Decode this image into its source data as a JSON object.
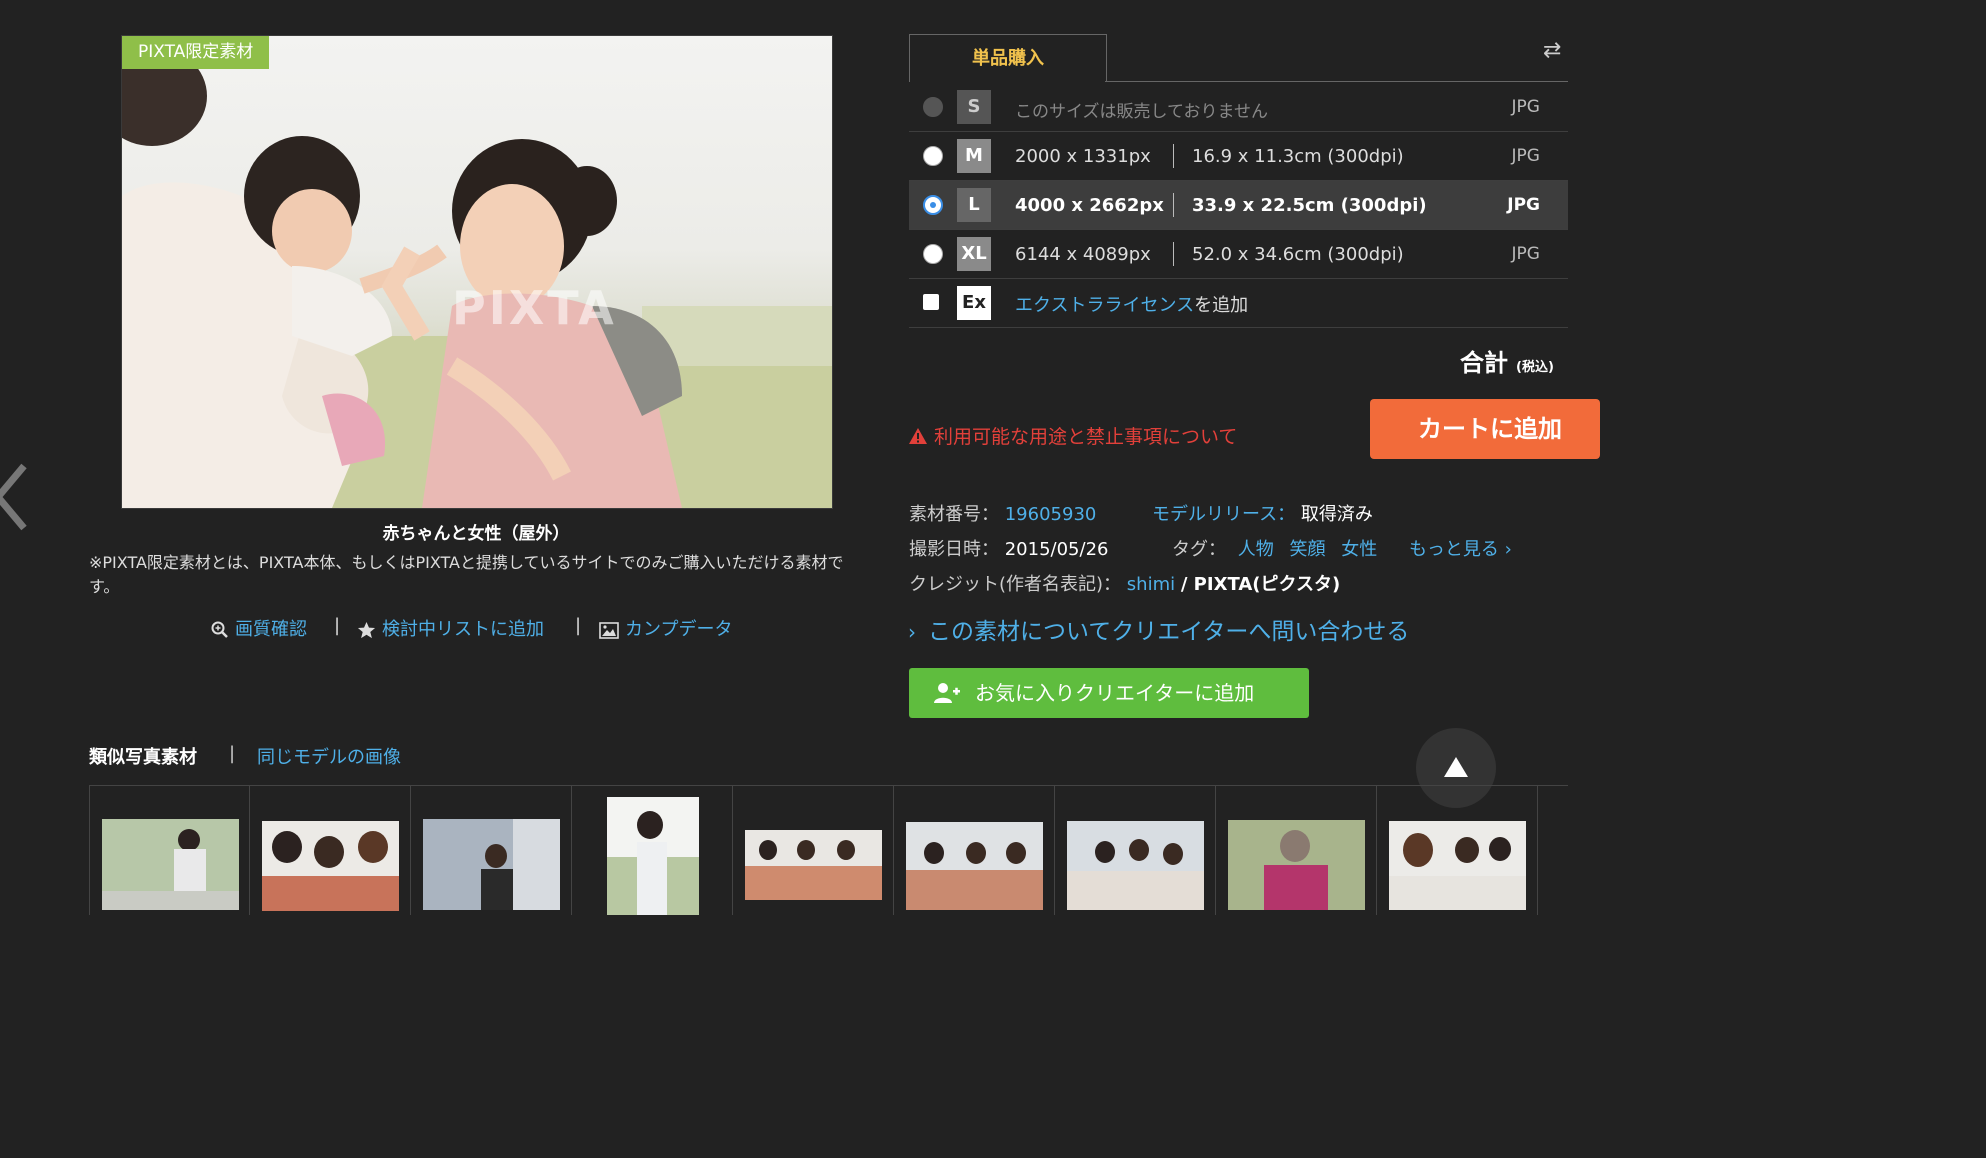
{
  "photo": {
    "badge": "PIXTA限定素材",
    "watermark": "PIXTA",
    "caption": "赤ちゃんと女性（屋外）",
    "note": "※PIXTA限定素材とは、PIXTA本体、もしくはPIXTAと提携しているサイトでのみご購入いただける素材です。"
  },
  "tools": {
    "quality": "画質確認",
    "sep": "|",
    "watchlist": "検討中リストに追加",
    "comp": "カンプデータ"
  },
  "purchase": {
    "tab": "単品購入",
    "swap_icon": "⇄",
    "rows": [
      {
        "size": "S",
        "unavailable": "このサイズは販売しておりません",
        "fmt": "JPG"
      },
      {
        "size": "M",
        "px": "2000 x 1331px",
        "cm": "16.9 x 11.3cm (300dpi)",
        "fmt": "JPG"
      },
      {
        "size": "L",
        "px": "4000 x 2662px",
        "cm": "33.9 x 22.5cm (300dpi)",
        "fmt": "JPG"
      },
      {
        "size": "XL",
        "px": "6144 x 4089px",
        "cm": "52.0 x 34.6cm (300dpi)",
        "fmt": "JPG"
      }
    ],
    "extra": {
      "size": "Ex",
      "link": "エクストラライセンス",
      "suffix": "を追加"
    },
    "selected_size": "L",
    "total_label": "合計",
    "total_tax": "(税込)",
    "warning": "利用可能な用途と禁止事項について",
    "cart_button": "カートに追加"
  },
  "meta": {
    "id_label": "素材番号：",
    "id_value": "19605930",
    "release_label": "モデルリリース：",
    "release_value": "取得済み",
    "date_label": "撮影日時：",
    "date_value": "2015/05/26",
    "tags_label": "タグ：",
    "tags": [
      "人物",
      "笑顔",
      "女性"
    ],
    "more": "もっと見る",
    "credit_label": "クレジット(作者名表記)：",
    "credit_author": "shimi",
    "credit_suffix": "/ PIXTA(ピクスタ)"
  },
  "inquiry": "この素材についてクリエイターへ問い合わせる",
  "fav_button": "お気に入りクリエイターに追加",
  "similar": {
    "heading": "類似写真素材",
    "sep": "|",
    "same_model": "同じモデルの画像"
  }
}
